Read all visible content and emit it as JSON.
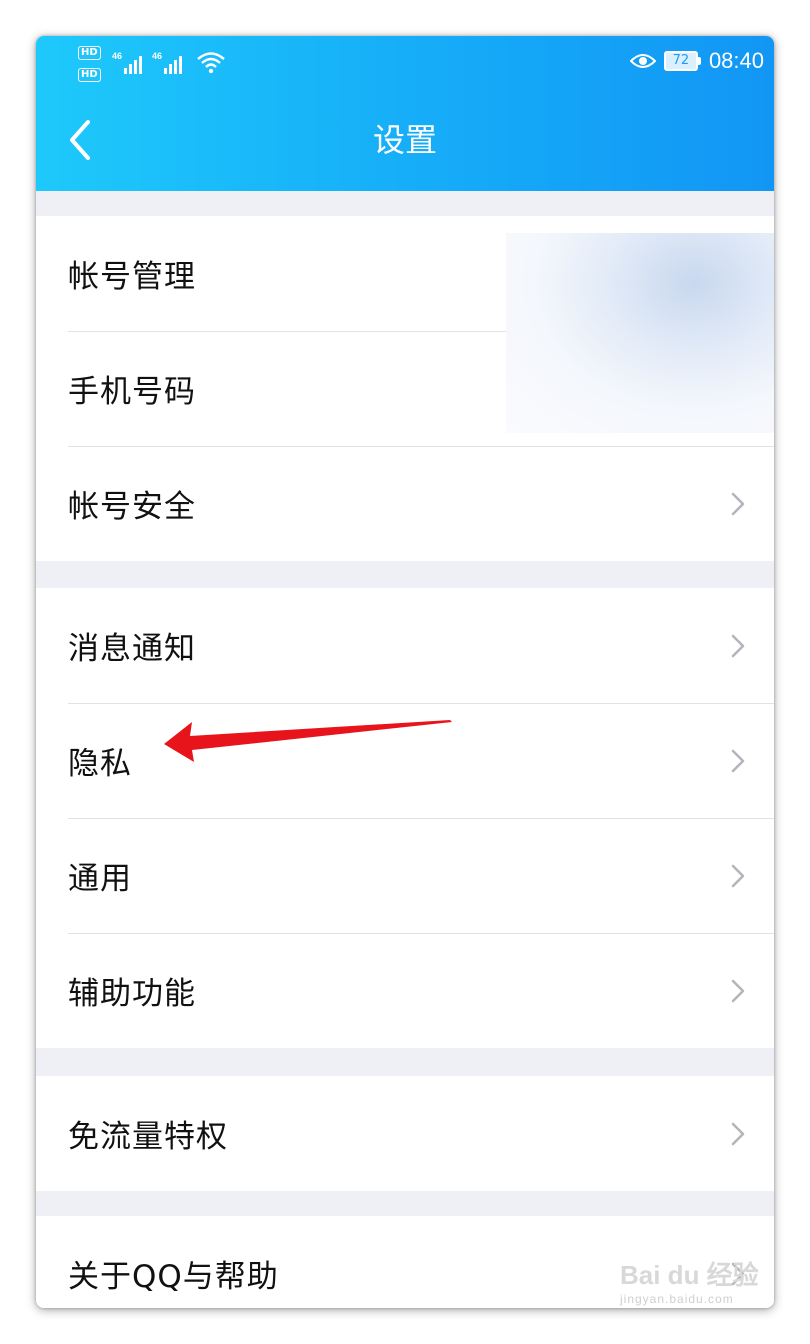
{
  "status_bar": {
    "network_left": "HD",
    "signal_1": "4G",
    "signal_2": "4G",
    "battery": "72",
    "time": "08:40"
  },
  "header": {
    "title": "设置",
    "back_icon": "chevron-left-icon"
  },
  "groups": [
    {
      "items": [
        {
          "label": "帐号管理"
        },
        {
          "label": "手机号码"
        },
        {
          "label": "帐号安全"
        }
      ]
    },
    {
      "items": [
        {
          "label": "消息通知"
        },
        {
          "label": "隐私"
        },
        {
          "label": "通用"
        },
        {
          "label": "辅助功能"
        }
      ]
    },
    {
      "items": [
        {
          "label": "免流量特权"
        }
      ]
    },
    {
      "items": [
        {
          "label": "关于QQ与帮助"
        }
      ]
    }
  ],
  "watermark": {
    "logo": "Bai du 经验",
    "url": "jingyan.baidu.com"
  },
  "colors": {
    "header_gradient_start": "#1ec9fb",
    "header_gradient_end": "#1296f5",
    "annotation_arrow": "#e8141c",
    "background": "#eff0f5"
  }
}
